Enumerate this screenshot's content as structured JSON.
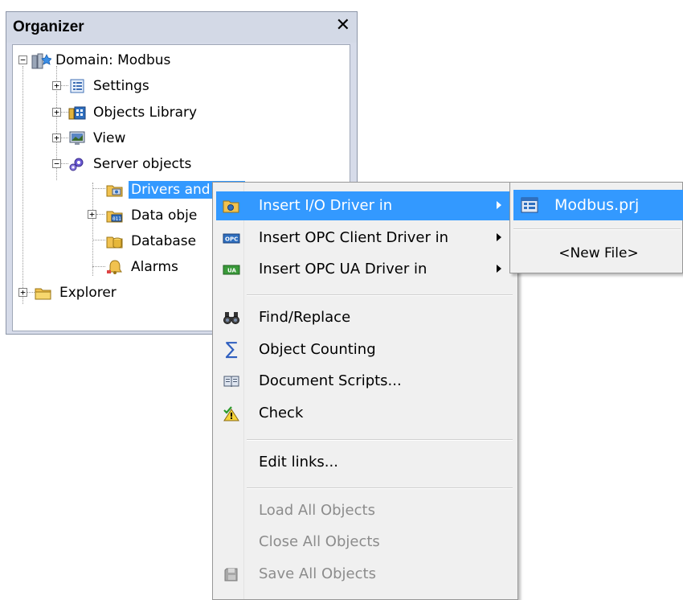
{
  "organizer": {
    "title": "Organizer",
    "close_glyph": "✕",
    "tree": [
      {
        "label": "Domain: Modbus",
        "icon": "domain-icon",
        "expander": "−"
      },
      {
        "label": "Settings",
        "icon": "settings-icon",
        "expander": "+"
      },
      {
        "label": "Objects Library",
        "icon": "objects-library-icon",
        "expander": "+"
      },
      {
        "label": "View",
        "icon": "view-icon",
        "expander": "+"
      },
      {
        "label": "Server objects",
        "icon": "server-objects-icon",
        "expander": "−"
      },
      {
        "label": "Drivers and OPC",
        "icon": "drivers-folder-icon",
        "selected": true
      },
      {
        "label": "Data obje",
        "icon": "data-objects-icon",
        "expander": "+"
      },
      {
        "label": "Database",
        "icon": "database-icon"
      },
      {
        "label": "Alarms",
        "icon": "alarms-icon"
      },
      {
        "label": "Explorer",
        "icon": "explorer-folder-icon",
        "expander": "+"
      }
    ]
  },
  "context_menu": {
    "items": [
      {
        "label": "Insert I/O Driver in",
        "icon": "io-driver-icon",
        "submenu": true,
        "highlighted": true
      },
      {
        "label": "Insert OPC Client Driver in",
        "icon": "opc-client-icon",
        "submenu": true
      },
      {
        "label": "Insert OPC UA Driver in",
        "icon": "opc-ua-icon",
        "submenu": true
      },
      {
        "label": "Find/Replace",
        "icon": "binoculars-icon"
      },
      {
        "label": "Object Counting",
        "icon": "sigma-icon"
      },
      {
        "label": "Document Scripts...",
        "icon": "book-icon"
      },
      {
        "label": "Check",
        "icon": "warning-check-icon"
      },
      {
        "label": "Edit links..."
      },
      {
        "label": "Load All Objects",
        "disabled": true
      },
      {
        "label": "Close All Objects",
        "disabled": true
      },
      {
        "label": "Save All Objects",
        "icon": "save-icon",
        "disabled": true
      }
    ]
  },
  "submenu": {
    "items": [
      {
        "label": "Modbus.prj",
        "icon": "project-file-icon",
        "highlighted": true
      },
      {
        "label": "<New File>"
      }
    ]
  },
  "colors": {
    "highlight": "#3399ff",
    "panel_bg": "#d6dbe9",
    "menu_bg": "#f0f0f0",
    "disabled_text": "#8c8c8c"
  }
}
